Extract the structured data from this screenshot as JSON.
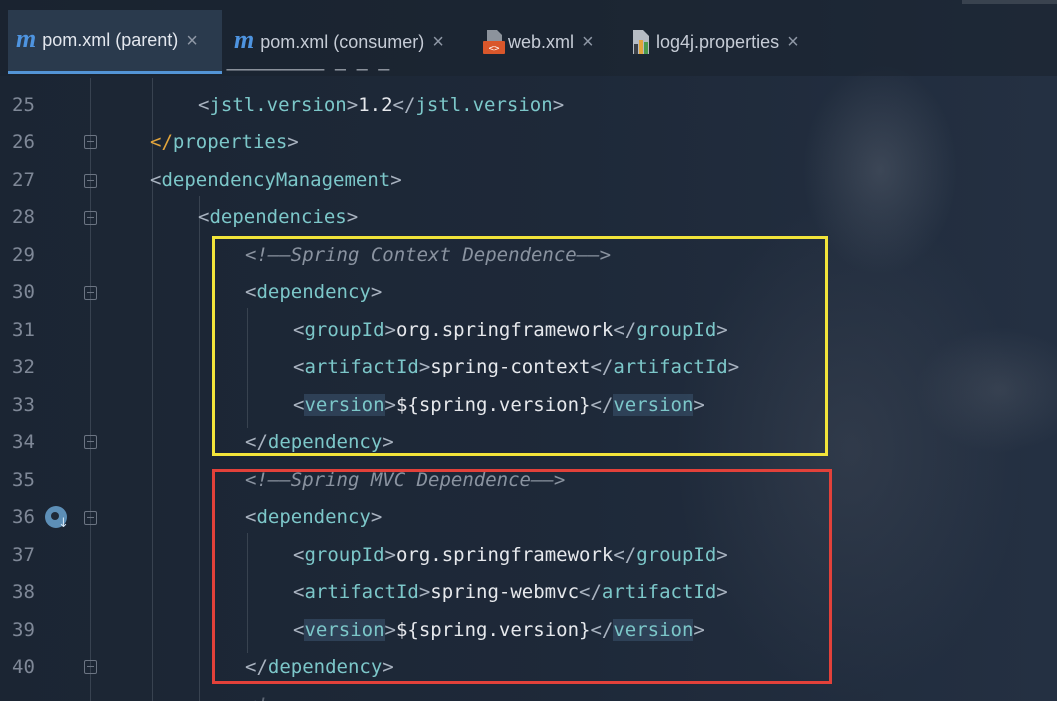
{
  "tabs": [
    {
      "label": "pom.xml (parent)",
      "icon": "maven-icon",
      "active": true
    },
    {
      "label": "pom.xml (consumer)",
      "icon": "maven-icon",
      "active": false
    },
    {
      "label": "web.xml",
      "icon": "xml-file-icon",
      "active": false
    },
    {
      "label": "log4j.properties",
      "icon": "properties-file-icon",
      "active": false
    }
  ],
  "close_glyph": "×",
  "maven_glyph": "m",
  "line_numbers": [
    "25",
    "26",
    "27",
    "28",
    "29",
    "30",
    "31",
    "32",
    "33",
    "34",
    "35",
    "36",
    "37",
    "38",
    "39",
    "40"
  ],
  "code": {
    "l25": {
      "open": "jstl.version",
      "value": "1.2",
      "close": "jstl.version"
    },
    "l26": {
      "close": "properties"
    },
    "l27": {
      "open": "dependencyManagement"
    },
    "l28": {
      "open": "dependencies"
    },
    "l29": {
      "comment": "<!——Spring Context Dependence——>"
    },
    "l30": {
      "open": "dependency"
    },
    "l31": {
      "open": "groupId",
      "value": "org.springframework",
      "close": "groupId"
    },
    "l32": {
      "open": "artifactId",
      "value": "spring-context",
      "close": "artifactId"
    },
    "l33": {
      "open": "version",
      "value": "${spring.version}",
      "close": "version"
    },
    "l34": {
      "close": "dependency"
    },
    "l35": {
      "comment": "<!——Spring MVC Dependence——>"
    },
    "l36": {
      "open": "dependency"
    },
    "l37": {
      "open": "groupId",
      "value": "org.springframework",
      "close": "groupId"
    },
    "l38": {
      "open": "artifactId",
      "value": "spring-webmvc",
      "close": "artifactId"
    },
    "l39": {
      "open": "version",
      "value": "${spring.version}",
      "close": "version"
    },
    "l40": {
      "close": "dependency"
    }
  },
  "colors": {
    "context_box": "#f2e43a",
    "mvc_box": "#e2413a",
    "tag": "#7cc7c9",
    "active_tab_underline": "#5394d6"
  }
}
